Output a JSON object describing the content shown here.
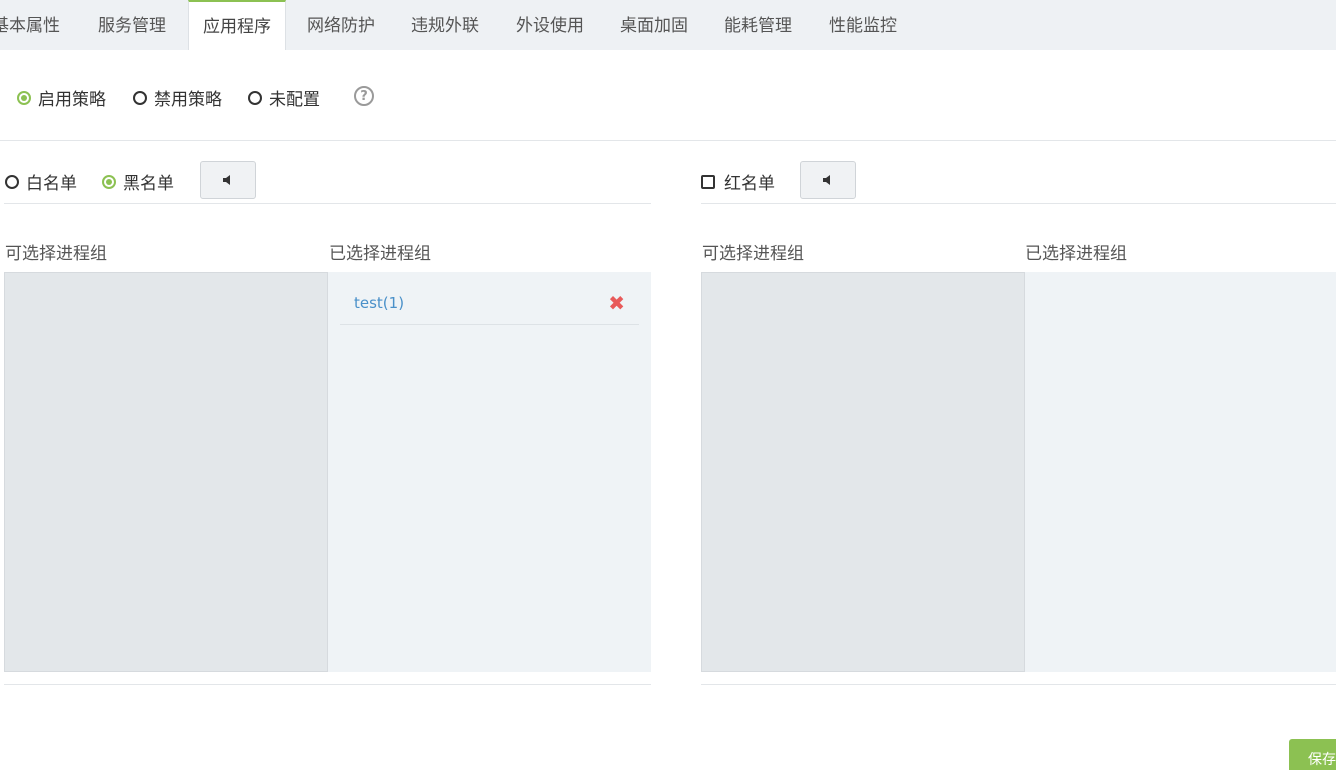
{
  "tabs": [
    {
      "label": "基本属性",
      "active": false
    },
    {
      "label": "服务管理",
      "active": false
    },
    {
      "label": "应用程序",
      "active": true
    },
    {
      "label": "网络防护",
      "active": false
    },
    {
      "label": "违规外联",
      "active": false
    },
    {
      "label": "外设使用",
      "active": false
    },
    {
      "label": "桌面加固",
      "active": false
    },
    {
      "label": "能耗管理",
      "active": false
    },
    {
      "label": "性能监控",
      "active": false
    }
  ],
  "policy": {
    "options": [
      {
        "label": "启用策略",
        "checked": true
      },
      {
        "label": "禁用策略",
        "checked": false
      },
      {
        "label": "未配置",
        "checked": false
      }
    ],
    "help_glyph": "?"
  },
  "left_section": {
    "list_type_options": [
      {
        "label": "白名单",
        "checked": false
      },
      {
        "label": "黑名单",
        "checked": true
      }
    ],
    "sound_icon": "speaker-icon",
    "available_title": "可选择进程组",
    "selected_title": "已选择进程组",
    "available_items": [],
    "selected_items": [
      {
        "label": "test(1)"
      }
    ]
  },
  "right_section": {
    "redlist_label": "红名单",
    "redlist_checked": false,
    "sound_icon": "speaker-icon",
    "available_title": "可选择进程组",
    "selected_title": "已选择进程组",
    "available_items": [],
    "selected_items": []
  },
  "actions": {
    "save_label": "保存"
  },
  "colors": {
    "accent": "#8cc152",
    "tab_bar_bg": "#eef1f4",
    "link": "#4a90c9",
    "remove": "#e85a5a"
  }
}
